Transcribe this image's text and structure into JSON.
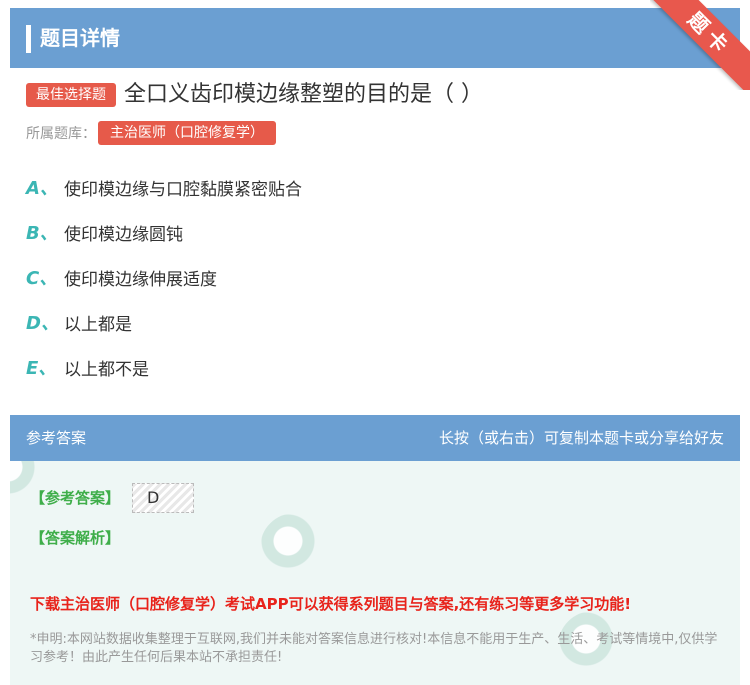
{
  "header": {
    "title": "题目详情"
  },
  "ribbon": {
    "label": "题卡"
  },
  "question": {
    "type_tag": "最佳选择题",
    "text": "全口义齿印模边缘整塑的目的是（ ）",
    "library_label": "所属题库：",
    "library_tag": "主治医师（口腔修复学）"
  },
  "options": [
    {
      "letter": "A、",
      "text": "使印模边缘与口腔黏膜紧密贴合"
    },
    {
      "letter": "B、",
      "text": "使印模边缘圆钝"
    },
    {
      "letter": "C、",
      "text": "使印模边缘伸展适度"
    },
    {
      "letter": "D、",
      "text": "以上都是"
    },
    {
      "letter": "E、",
      "text": "以上都不是"
    }
  ],
  "answer": {
    "section_title": "参考答案",
    "hint": "长按（或右击）可复制本题卡或分享给好友",
    "answer_label": "【参考答案】",
    "answer_value": "D",
    "explanation_label": "【答案解析】",
    "promo": "下载主治医师（口腔修复学）考试APP可以获得系列题目与答案,还有练习等更多学习功能!",
    "disclaimer": "*申明:本网站数据收集整理于互联网,我们并未能对答案信息进行核对!本信息不能用于生产、生活、考试等情境中,仅供学习参考！由此产生任何后果本站不承担责任!"
  },
  "colors": {
    "header_blue": "#6b9fd2",
    "tag_red": "#e65a4a",
    "option_letter": "#3bb6b4",
    "answer_green": "#3fae4a",
    "promo_red": "#e8231b"
  }
}
